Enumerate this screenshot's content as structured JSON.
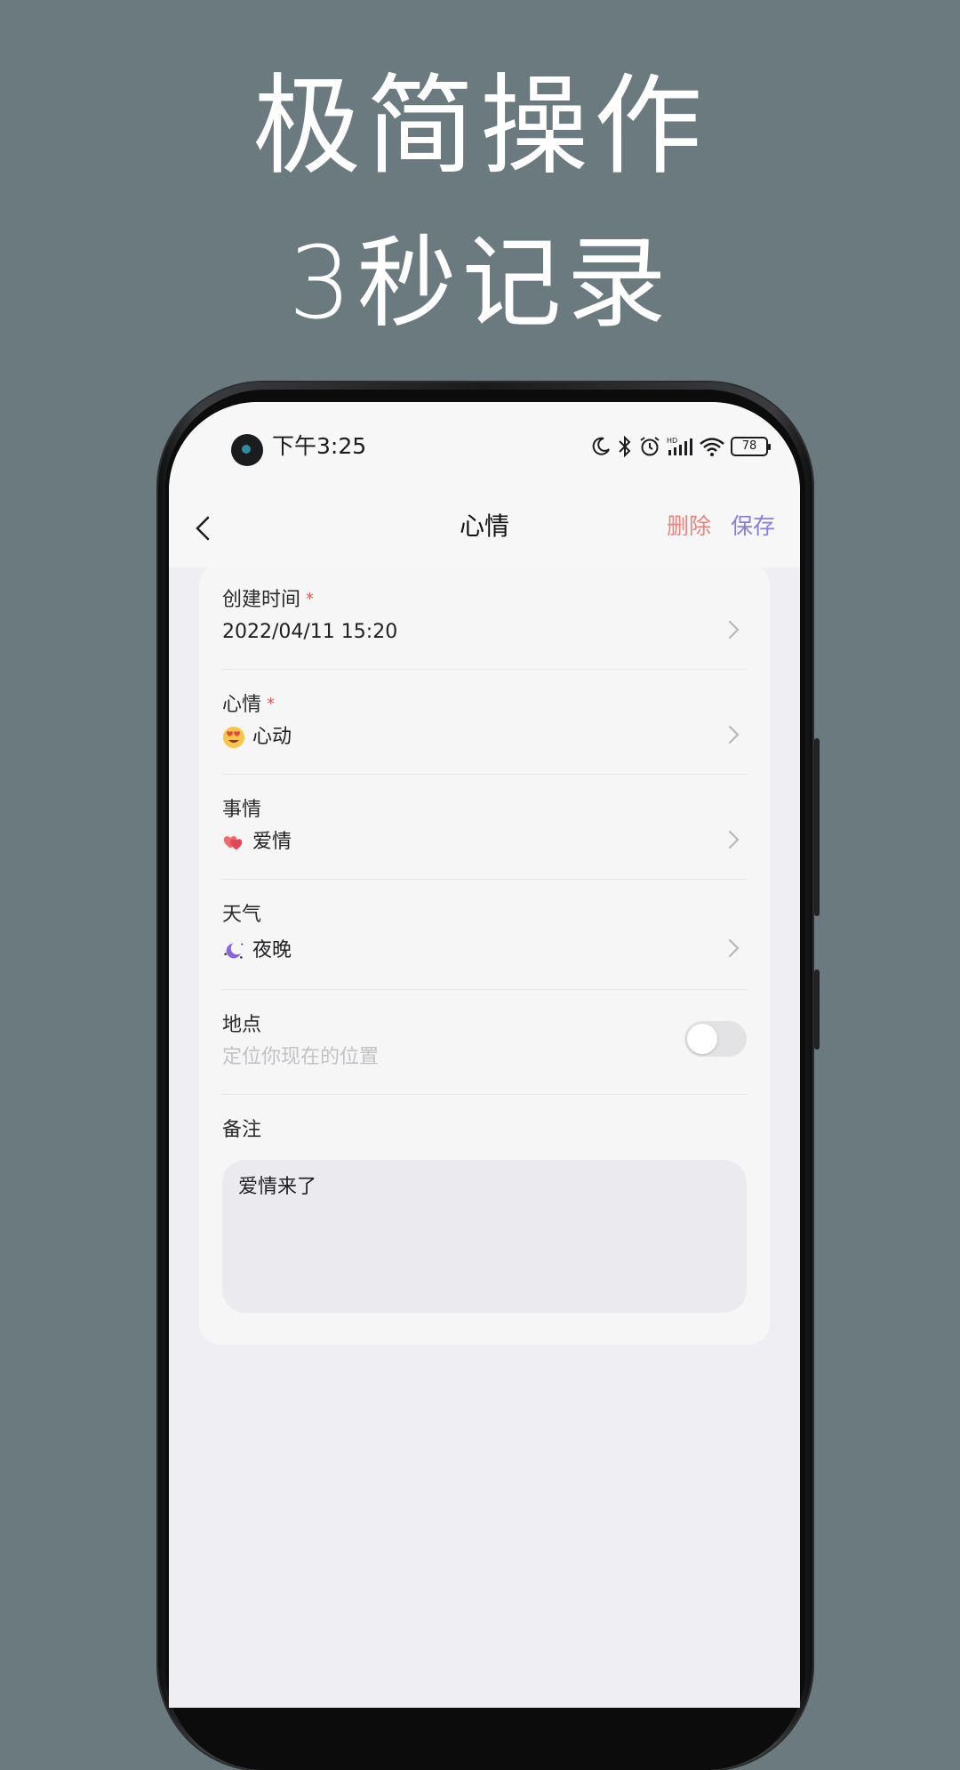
{
  "hero": {
    "line1": "极简操作",
    "line2": "3秒记录"
  },
  "status_bar": {
    "time": "下午3:25",
    "battery": "78",
    "icons": [
      "moon-icon",
      "bluetooth-icon",
      "alarm-icon",
      "signal-icon",
      "wifi-icon",
      "battery-icon"
    ]
  },
  "nav": {
    "title": "心情",
    "delete_label": "删除",
    "save_label": "保存"
  },
  "form": {
    "created_time": {
      "label": "创建时间",
      "required_mark": "*",
      "value": "2022/04/11 15:20"
    },
    "mood": {
      "label": "心情",
      "required_mark": "*",
      "value": "心动",
      "icon": "heart-eyes-emoji-icon"
    },
    "event": {
      "label": "事情",
      "value": "爱情",
      "icon": "hearts-icon"
    },
    "weather": {
      "label": "天气",
      "value": "夜晚",
      "icon": "moon-night-icon"
    },
    "location": {
      "label": "地点",
      "placeholder": "定位你现在的位置",
      "enabled": false
    },
    "note": {
      "label": "备注",
      "value": "爱情来了"
    }
  },
  "colors": {
    "background": "#6a7a7e",
    "delete": "#e7857d",
    "save": "#8a7fd6",
    "required": "#e05a52"
  }
}
